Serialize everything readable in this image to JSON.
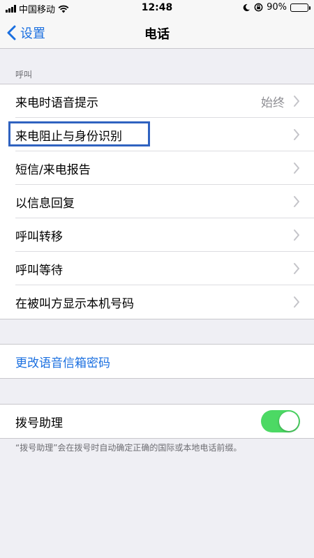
{
  "status_bar": {
    "carrier": "中国移动",
    "time": "12:48",
    "battery": "90%",
    "battery_level": 0.9,
    "icons": [
      "signal-icon",
      "wifi-icon",
      "moon-icon",
      "orientation-lock-icon",
      "battery-icon"
    ]
  },
  "nav": {
    "back_label": "设置",
    "title": "电话"
  },
  "calls_section": {
    "header": "呼叫",
    "rows": [
      {
        "label": "来电时语音提示",
        "detail": "始终"
      },
      {
        "label": "来电阻止与身份识别",
        "detail": ""
      },
      {
        "label": "短信/来电报告",
        "detail": ""
      },
      {
        "label": "以信息回复",
        "detail": ""
      },
      {
        "label": "呼叫转移",
        "detail": ""
      },
      {
        "label": "呼叫等待",
        "detail": ""
      },
      {
        "label": "在被叫方显示本机号码",
        "detail": ""
      }
    ]
  },
  "voicemail": {
    "change_password": "更改语音信箱密码"
  },
  "dial_assist": {
    "label": "拨号助理",
    "enabled": true,
    "footer": "“拨号助理”会在拨号时自动确定正确的国际或本地电话前缀。"
  },
  "colors": {
    "accent": "#1a6fe0",
    "toggle_on": "#4cd964",
    "highlight": "#2f62c0"
  }
}
